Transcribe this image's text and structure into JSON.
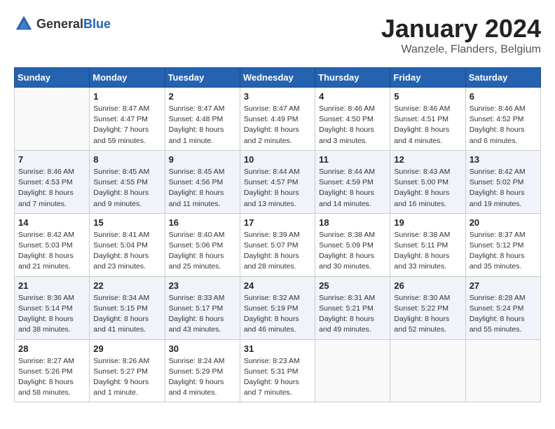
{
  "logo": {
    "general": "General",
    "blue": "Blue"
  },
  "title": "January 2024",
  "subtitle": "Wanzele, Flanders, Belgium",
  "weekdays": [
    "Sunday",
    "Monday",
    "Tuesday",
    "Wednesday",
    "Thursday",
    "Friday",
    "Saturday"
  ],
  "weeks": [
    [
      {
        "day": "",
        "info": ""
      },
      {
        "day": "1",
        "info": "Sunrise: 8:47 AM\nSunset: 4:47 PM\nDaylight: 7 hours\nand 59 minutes."
      },
      {
        "day": "2",
        "info": "Sunrise: 8:47 AM\nSunset: 4:48 PM\nDaylight: 8 hours\nand 1 minute."
      },
      {
        "day": "3",
        "info": "Sunrise: 8:47 AM\nSunset: 4:49 PM\nDaylight: 8 hours\nand 2 minutes."
      },
      {
        "day": "4",
        "info": "Sunrise: 8:46 AM\nSunset: 4:50 PM\nDaylight: 8 hours\nand 3 minutes."
      },
      {
        "day": "5",
        "info": "Sunrise: 8:46 AM\nSunset: 4:51 PM\nDaylight: 8 hours\nand 4 minutes."
      },
      {
        "day": "6",
        "info": "Sunrise: 8:46 AM\nSunset: 4:52 PM\nDaylight: 8 hours\nand 6 minutes."
      }
    ],
    [
      {
        "day": "7",
        "info": "Sunrise: 8:46 AM\nSunset: 4:53 PM\nDaylight: 8 hours\nand 7 minutes."
      },
      {
        "day": "8",
        "info": "Sunrise: 8:45 AM\nSunset: 4:55 PM\nDaylight: 8 hours\nand 9 minutes."
      },
      {
        "day": "9",
        "info": "Sunrise: 8:45 AM\nSunset: 4:56 PM\nDaylight: 8 hours\nand 11 minutes."
      },
      {
        "day": "10",
        "info": "Sunrise: 8:44 AM\nSunset: 4:57 PM\nDaylight: 8 hours\nand 13 minutes."
      },
      {
        "day": "11",
        "info": "Sunrise: 8:44 AM\nSunset: 4:59 PM\nDaylight: 8 hours\nand 14 minutes."
      },
      {
        "day": "12",
        "info": "Sunrise: 8:43 AM\nSunset: 5:00 PM\nDaylight: 8 hours\nand 16 minutes."
      },
      {
        "day": "13",
        "info": "Sunrise: 8:42 AM\nSunset: 5:02 PM\nDaylight: 8 hours\nand 19 minutes."
      }
    ],
    [
      {
        "day": "14",
        "info": "Sunrise: 8:42 AM\nSunset: 5:03 PM\nDaylight: 8 hours\nand 21 minutes."
      },
      {
        "day": "15",
        "info": "Sunrise: 8:41 AM\nSunset: 5:04 PM\nDaylight: 8 hours\nand 23 minutes."
      },
      {
        "day": "16",
        "info": "Sunrise: 8:40 AM\nSunset: 5:06 PM\nDaylight: 8 hours\nand 25 minutes."
      },
      {
        "day": "17",
        "info": "Sunrise: 8:39 AM\nSunset: 5:07 PM\nDaylight: 8 hours\nand 28 minutes."
      },
      {
        "day": "18",
        "info": "Sunrise: 8:38 AM\nSunset: 5:09 PM\nDaylight: 8 hours\nand 30 minutes."
      },
      {
        "day": "19",
        "info": "Sunrise: 8:38 AM\nSunset: 5:11 PM\nDaylight: 8 hours\nand 33 minutes."
      },
      {
        "day": "20",
        "info": "Sunrise: 8:37 AM\nSunset: 5:12 PM\nDaylight: 8 hours\nand 35 minutes."
      }
    ],
    [
      {
        "day": "21",
        "info": "Sunrise: 8:36 AM\nSunset: 5:14 PM\nDaylight: 8 hours\nand 38 minutes."
      },
      {
        "day": "22",
        "info": "Sunrise: 8:34 AM\nSunset: 5:15 PM\nDaylight: 8 hours\nand 41 minutes."
      },
      {
        "day": "23",
        "info": "Sunrise: 8:33 AM\nSunset: 5:17 PM\nDaylight: 8 hours\nand 43 minutes."
      },
      {
        "day": "24",
        "info": "Sunrise: 8:32 AM\nSunset: 5:19 PM\nDaylight: 8 hours\nand 46 minutes."
      },
      {
        "day": "25",
        "info": "Sunrise: 8:31 AM\nSunset: 5:21 PM\nDaylight: 8 hours\nand 49 minutes."
      },
      {
        "day": "26",
        "info": "Sunrise: 8:30 AM\nSunset: 5:22 PM\nDaylight: 8 hours\nand 52 minutes."
      },
      {
        "day": "27",
        "info": "Sunrise: 8:28 AM\nSunset: 5:24 PM\nDaylight: 8 hours\nand 55 minutes."
      }
    ],
    [
      {
        "day": "28",
        "info": "Sunrise: 8:27 AM\nSunset: 5:26 PM\nDaylight: 8 hours\nand 58 minutes."
      },
      {
        "day": "29",
        "info": "Sunrise: 8:26 AM\nSunset: 5:27 PM\nDaylight: 9 hours\nand 1 minute."
      },
      {
        "day": "30",
        "info": "Sunrise: 8:24 AM\nSunset: 5:29 PM\nDaylight: 9 hours\nand 4 minutes."
      },
      {
        "day": "31",
        "info": "Sunrise: 8:23 AM\nSunset: 5:31 PM\nDaylight: 9 hours\nand 7 minutes."
      },
      {
        "day": "",
        "info": ""
      },
      {
        "day": "",
        "info": ""
      },
      {
        "day": "",
        "info": ""
      }
    ]
  ]
}
